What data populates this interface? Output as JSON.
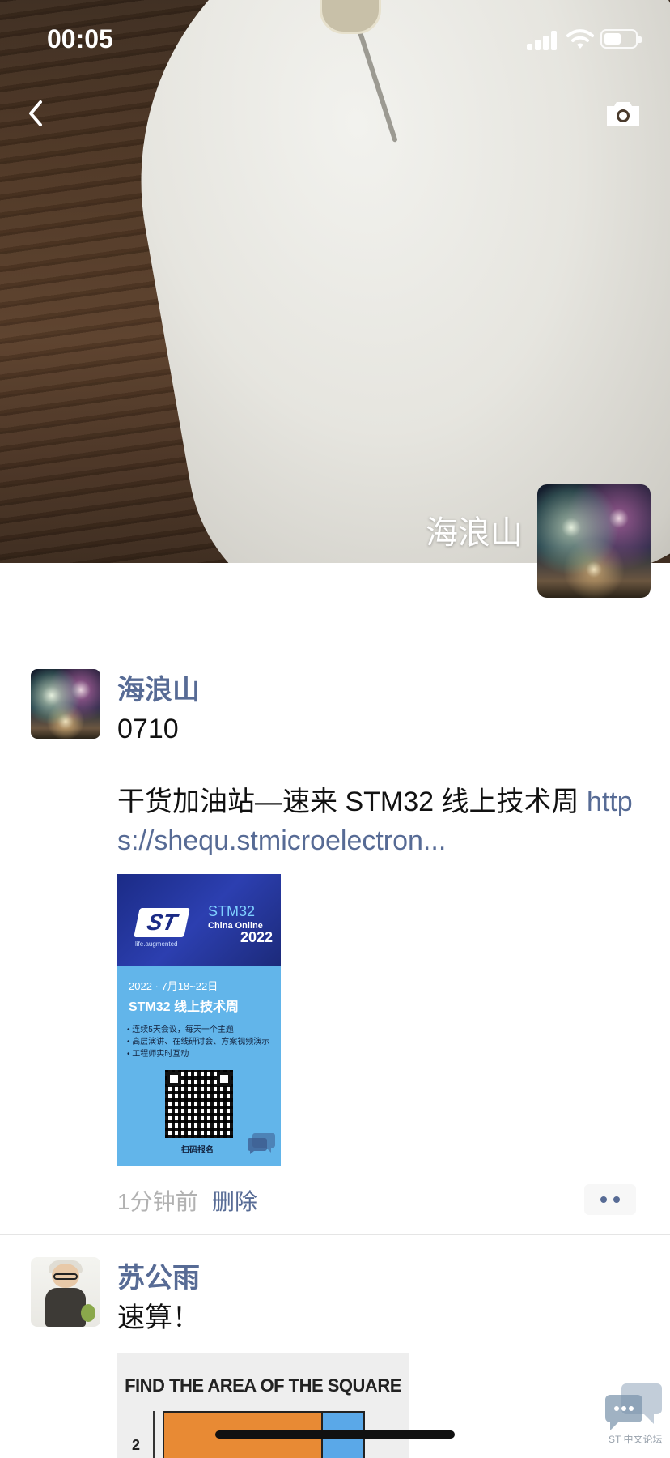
{
  "status_bar": {
    "time": "00:05"
  },
  "cover": {
    "name": "海浪山"
  },
  "posts": [
    {
      "author": "海浪山",
      "line1": "0710",
      "line2_prefix": "干货加油站—速来 STM32 线上技术周 ",
      "link": "https://shequ.stmicroelectron...",
      "link_part1": "http",
      "link_part2": "s://shequ.stmicroelectron...",
      "poster": {
        "logo": "ST",
        "tagline": "life.augmented",
        "stm": "STM32",
        "china_online": "China Online",
        "year": "2022",
        "date": "2022 · 7月18~22日",
        "title": "STM32 线上技术周",
        "bullets": [
          "• 连续5天会议，每天一个主题",
          "• 高层演讲、在线研讨会、方案视频演示",
          "• 工程师实时互动"
        ],
        "scan": "扫码报名"
      },
      "time": "1分钟前",
      "delete": "删除"
    },
    {
      "author": "苏公雨",
      "text": "速算！",
      "quiz": {
        "title": "FIND THE AREA OF THE SQUARE",
        "label": "2"
      }
    }
  ],
  "watermark": "ST 中文论坛",
  "icons": [
    "signal-icon",
    "wifi-icon",
    "battery-icon",
    "back-icon",
    "camera-icon",
    "more-icon",
    "chat-icon"
  ]
}
